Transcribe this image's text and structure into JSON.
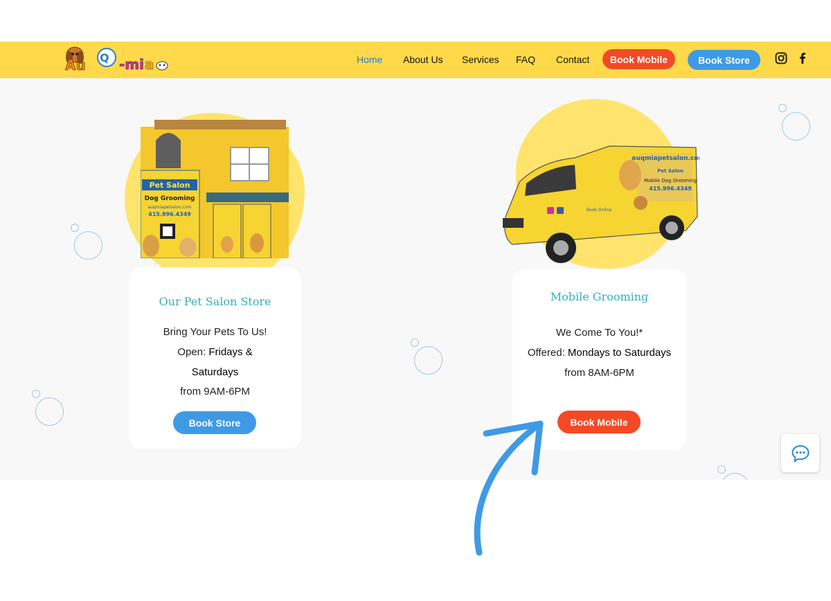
{
  "logo": {
    "text": "Au-Q-mia"
  },
  "nav": {
    "home": "Home",
    "about": "About Us",
    "services": "Services",
    "faq": "FAQ",
    "contact": "Contact",
    "book_mobile": "Book Mobile",
    "book_store": "Book Store"
  },
  "social": {
    "instagram": "instagram-icon",
    "facebook": "facebook-icon"
  },
  "store_card": {
    "image_sign_top": "Pet Salon",
    "image_sign_main": "Dog Grooming",
    "image_sign_url": "auqmiapetsalon.com",
    "image_sign_phone": "415.996.4349",
    "title": "Our Pet Salon Store",
    "line1": "Bring Your Pets To Us!",
    "open_prefix": "Open: ",
    "open_days_1": "Fridays &",
    "open_days_2": "Saturdays",
    "hours": "from 9AM-6PM",
    "button": "Book Store"
  },
  "mobile_card": {
    "van_url": "auqmiapetsalon.com",
    "van_brand": "Pet Salon",
    "van_service": "Mobile Dog Grooming",
    "van_phone": "415.996.4349",
    "van_book": "Book Online",
    "title": "Mobile Grooming",
    "line1": "We Come To You!*",
    "offered_prefix": "Offered: ",
    "offered_days": "Mondays to Saturdays",
    "hours": "from 8AM-6PM",
    "button": "Book Mobile"
  },
  "colors": {
    "header": "#ffd94a",
    "red": "#f34a25",
    "blue": "#3f9ae5",
    "teal": "#35aebd",
    "blob": "#fee46c"
  }
}
